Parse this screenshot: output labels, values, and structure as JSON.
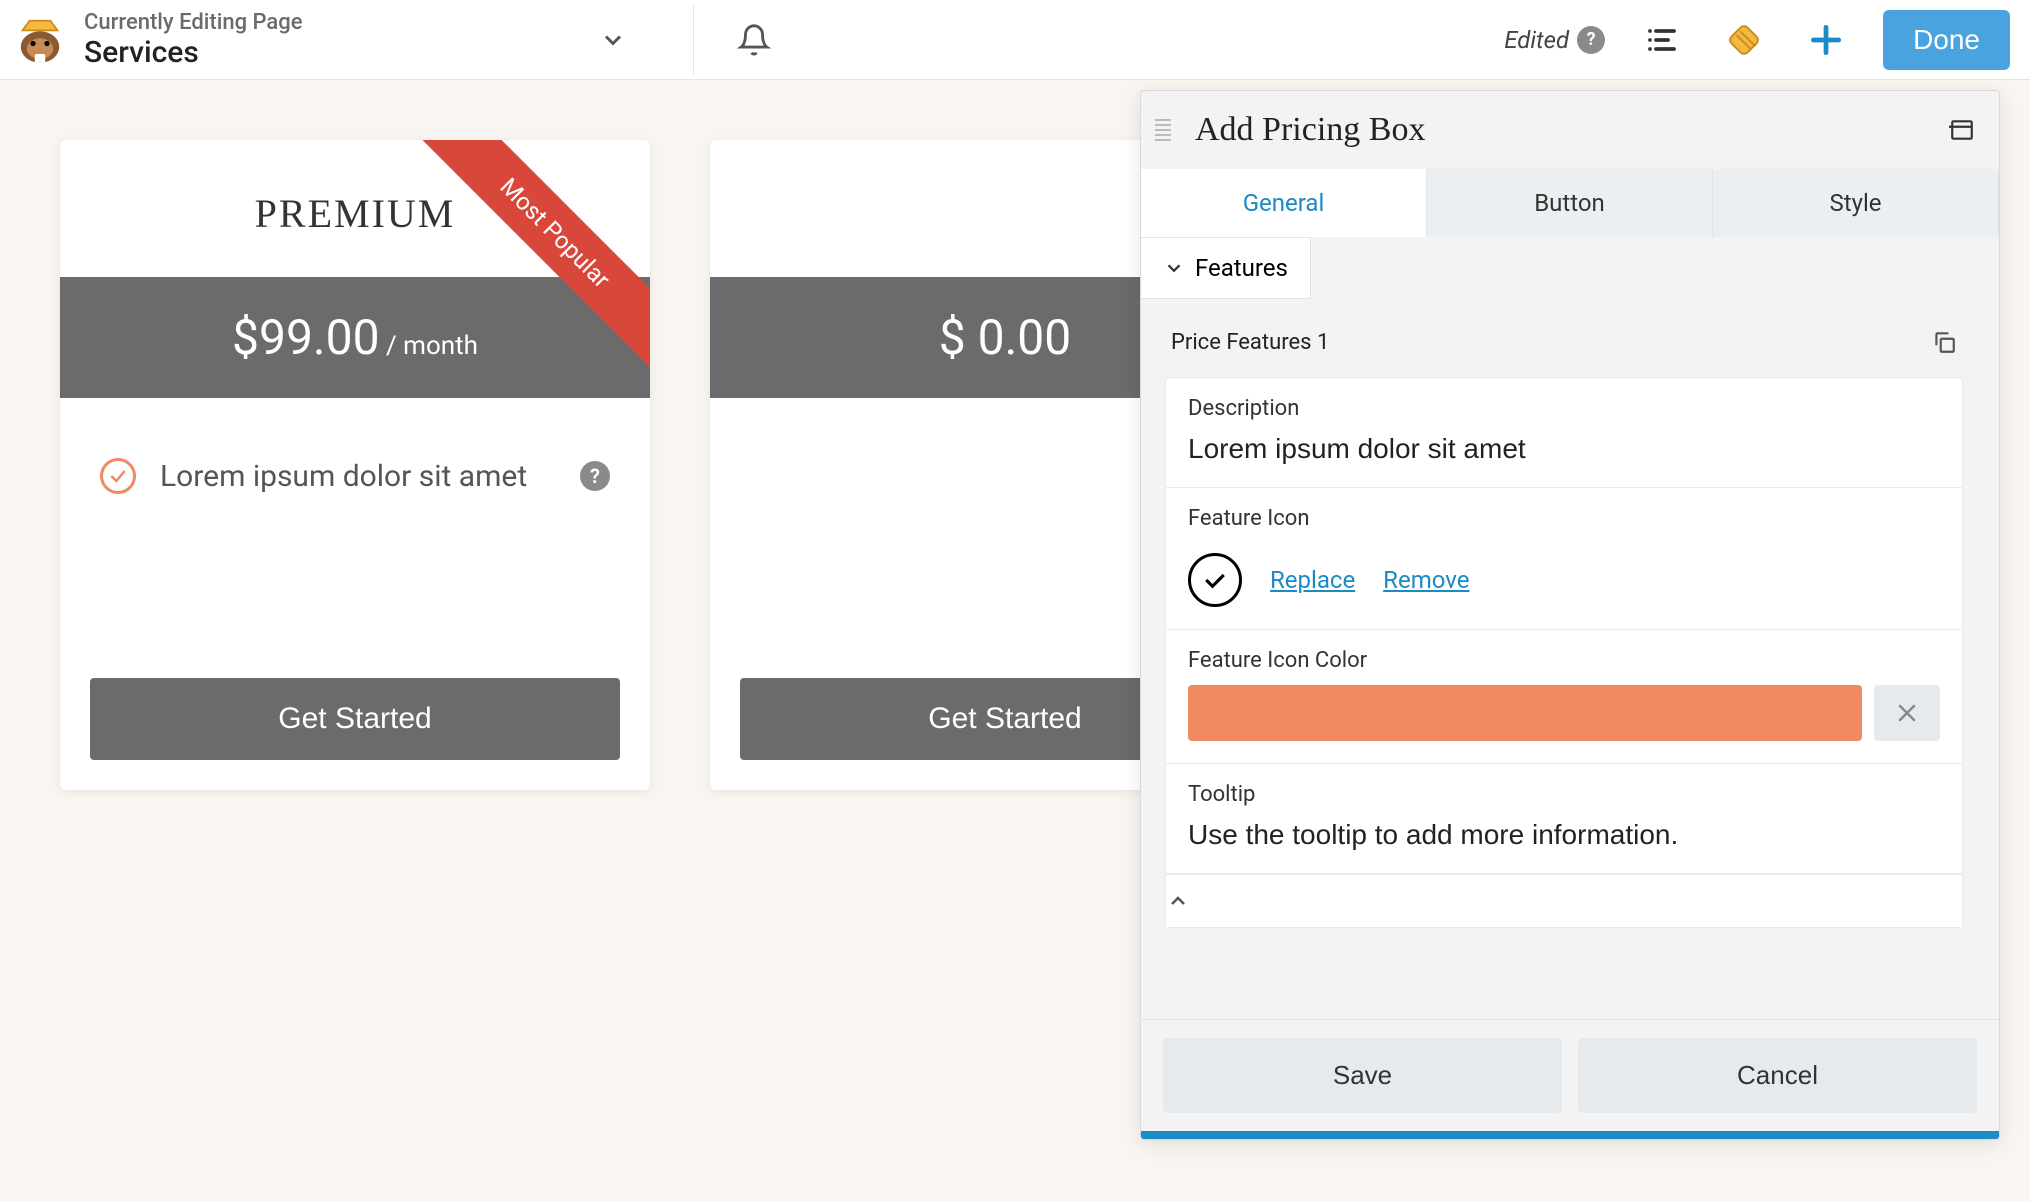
{
  "topbar": {
    "status_label": "Currently Editing Page",
    "page_name": "Services",
    "edited_label": "Edited",
    "done_label": "Done"
  },
  "canvas": {
    "cards": [
      {
        "title": "PREMIUM",
        "ribbon": "Most Popular",
        "price": "$99.00",
        "period": " / month",
        "feature_text": "Lorem ipsum dolor sit amet",
        "button": "Get Started"
      },
      {
        "title": "",
        "price": "$ 0.00",
        "period": "",
        "button": "Get Started"
      }
    ]
  },
  "panel": {
    "title": "Add Pricing Box",
    "tabs": [
      "General",
      "Button",
      "Style"
    ],
    "active_tab": 0,
    "accordion_label": "Features",
    "section_title": "Price Features 1",
    "fields": {
      "description_label": "Description",
      "description_value": "Lorem ipsum dolor sit amet",
      "feature_icon_label": "Feature Icon",
      "replace_link": "Replace",
      "remove_link": "Remove",
      "feature_icon_color_label": "Feature Icon Color",
      "feature_icon_color_value": "#ef8a63",
      "tooltip_label": "Tooltip",
      "tooltip_value": "Use the tooltip to add more information."
    },
    "footer": {
      "save": "Save",
      "cancel": "Cancel"
    }
  }
}
